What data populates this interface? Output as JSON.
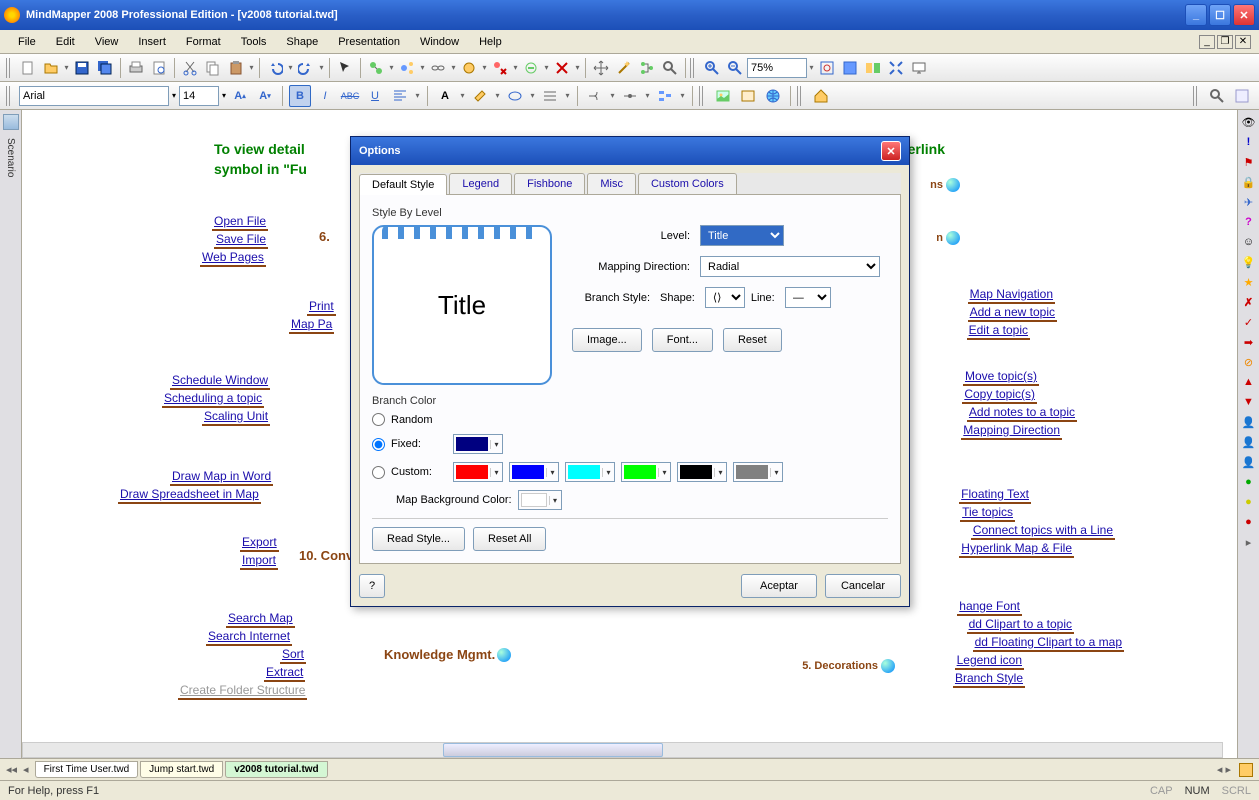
{
  "app": {
    "title": "MindMapper 2008 Professional Edition - [v2008 tutorial.twd]"
  },
  "menu": {
    "items": [
      "File",
      "Edit",
      "View",
      "Insert",
      "Format",
      "Tools",
      "Shape",
      "Presentation",
      "Window",
      "Help"
    ]
  },
  "fontbar": {
    "font": "Arial",
    "size": "14"
  },
  "toolbar2": {
    "zoom": "75%"
  },
  "leftpanel": {
    "label": "Scenario"
  },
  "canvas": {
    "hint1": "To view detail",
    "hint2": "symbol in \"Fu",
    "left": {
      "g1": [
        "Open File",
        "Save File",
        "Web Pages"
      ],
      "g1cat": "6.",
      "g2": [
        "Print",
        "Map Pa"
      ],
      "g3": [
        "Schedule Window",
        "Scheduling a topic",
        "Scaling Unit"
      ],
      "g4": [
        "Draw Map in Word",
        "Draw Spreadsheet in Map"
      ],
      "g5": [
        "Export",
        "Import"
      ],
      "g5cat": "10. Conv",
      "g6": [
        "Search Map",
        "Search Internet",
        "Sort",
        "Extract",
        "Create Folder Structure"
      ]
    },
    "center": {
      "knowledge": "Knowledge Mgmt."
    },
    "right": {
      "rcat1": "ns",
      "rcat2": "n",
      "rcat5": "5. Decorations",
      "g1": [
        "Map Navigation",
        "Add a new topic",
        "Edit a topic"
      ],
      "g2": [
        "Move topic(s)",
        "Copy topic(s)",
        "Add notes to a topic",
        "Mapping Direction"
      ],
      "g3": [
        "Floating Text",
        "Tie topics",
        "Connect topics with a Line",
        "Hyperlink Map & File"
      ],
      "g4": [
        "hange Font",
        "dd Clipart to a topic",
        "dd Floating Clipart to a map",
        "Legend icon",
        "Branch Style"
      ],
      "hyperlink": "hyperlink"
    }
  },
  "dialog": {
    "title": "Options",
    "tabs": [
      "Default Style",
      "Legend",
      "Fishbone",
      "Misc",
      "Custom Colors"
    ],
    "section1": "Style By Level",
    "preview": "Title",
    "level_lbl": "Level:",
    "level_val": "Title",
    "mapdir_lbl": "Mapping Direction:",
    "mapdir_val": "Radial",
    "branch_lbl": "Branch Style:",
    "shape_lbl": "Shape:",
    "line_lbl": "Line:",
    "btn_image": "Image...",
    "btn_font": "Font...",
    "btn_reset": "Reset",
    "section2": "Branch Color",
    "radio_random": "Random",
    "radio_fixed": "Fixed:",
    "radio_custom": "Custom:",
    "bgcolor_lbl": "Map Background Color:",
    "btn_readstyle": "Read Style...",
    "btn_resetall": "Reset All",
    "btn_help": "?",
    "btn_ok": "Aceptar",
    "btn_cancel": "Cancelar",
    "colors": {
      "fixed": "#000080",
      "c1": "#ff0000",
      "c2": "#0000ff",
      "c3": "#00ffff",
      "c4": "#00ff00",
      "c5": "#000000",
      "c6": "#808080",
      "bg": "#ffffff"
    }
  },
  "doctabs": {
    "t1": "First Time User.twd",
    "t2": "Jump start.twd",
    "t3": "v2008 tutorial.twd"
  },
  "status": {
    "help": "For Help, press F1",
    "cap": "CAP",
    "num": "NUM",
    "scrl": "SCRL"
  }
}
